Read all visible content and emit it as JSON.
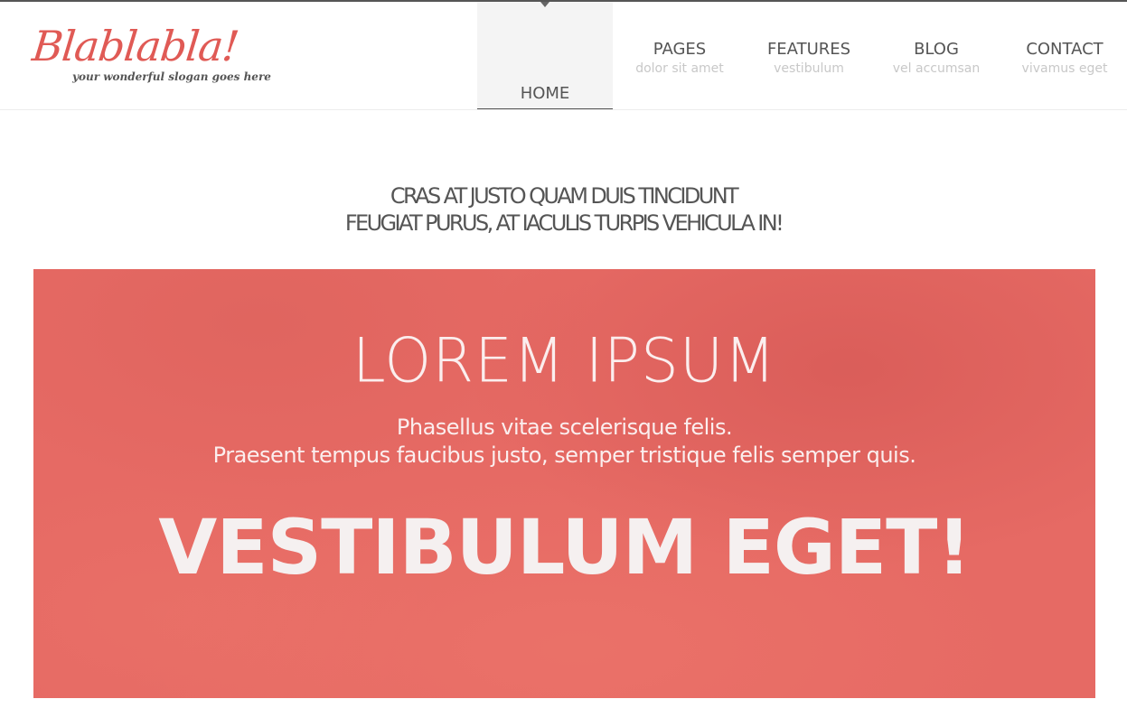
{
  "logo": {
    "name": "Blablabla!",
    "slogan": "your wonderful slogan goes here"
  },
  "nav": {
    "items": [
      {
        "label": "HOME",
        "sub": "",
        "active": true
      },
      {
        "label": "PAGES",
        "sub": "dolor sit amet",
        "active": false
      },
      {
        "label": "FEATURES",
        "sub": "vestibulum",
        "active": false
      },
      {
        "label": "BLOG",
        "sub": "vel accumsan",
        "active": false
      },
      {
        "label": "CONTACT",
        "sub": "vivamus eget",
        "active": false
      }
    ]
  },
  "tagline": {
    "line1": "CRAS AT JUSTO QUAM DUIS TINCIDUNT",
    "line2": "FEUGIAT PURUS, AT IACULIS TURPIS VEHICULA IN!"
  },
  "hero": {
    "title": "LOREM IPSUM",
    "sub_line1": "Phasellus vitae scelerisque felis.",
    "sub_line2": "Praesent tempus faucibus justo, semper tristique felis semper quis.",
    "cta": "VESTIBULUM EGET!"
  },
  "colors": {
    "brand": "#e05a55",
    "hero_background": "#e66a64",
    "nav_text": "#555555",
    "nav_subtext": "#c8c8c8",
    "active_tab_background": "#f4f4f4"
  }
}
